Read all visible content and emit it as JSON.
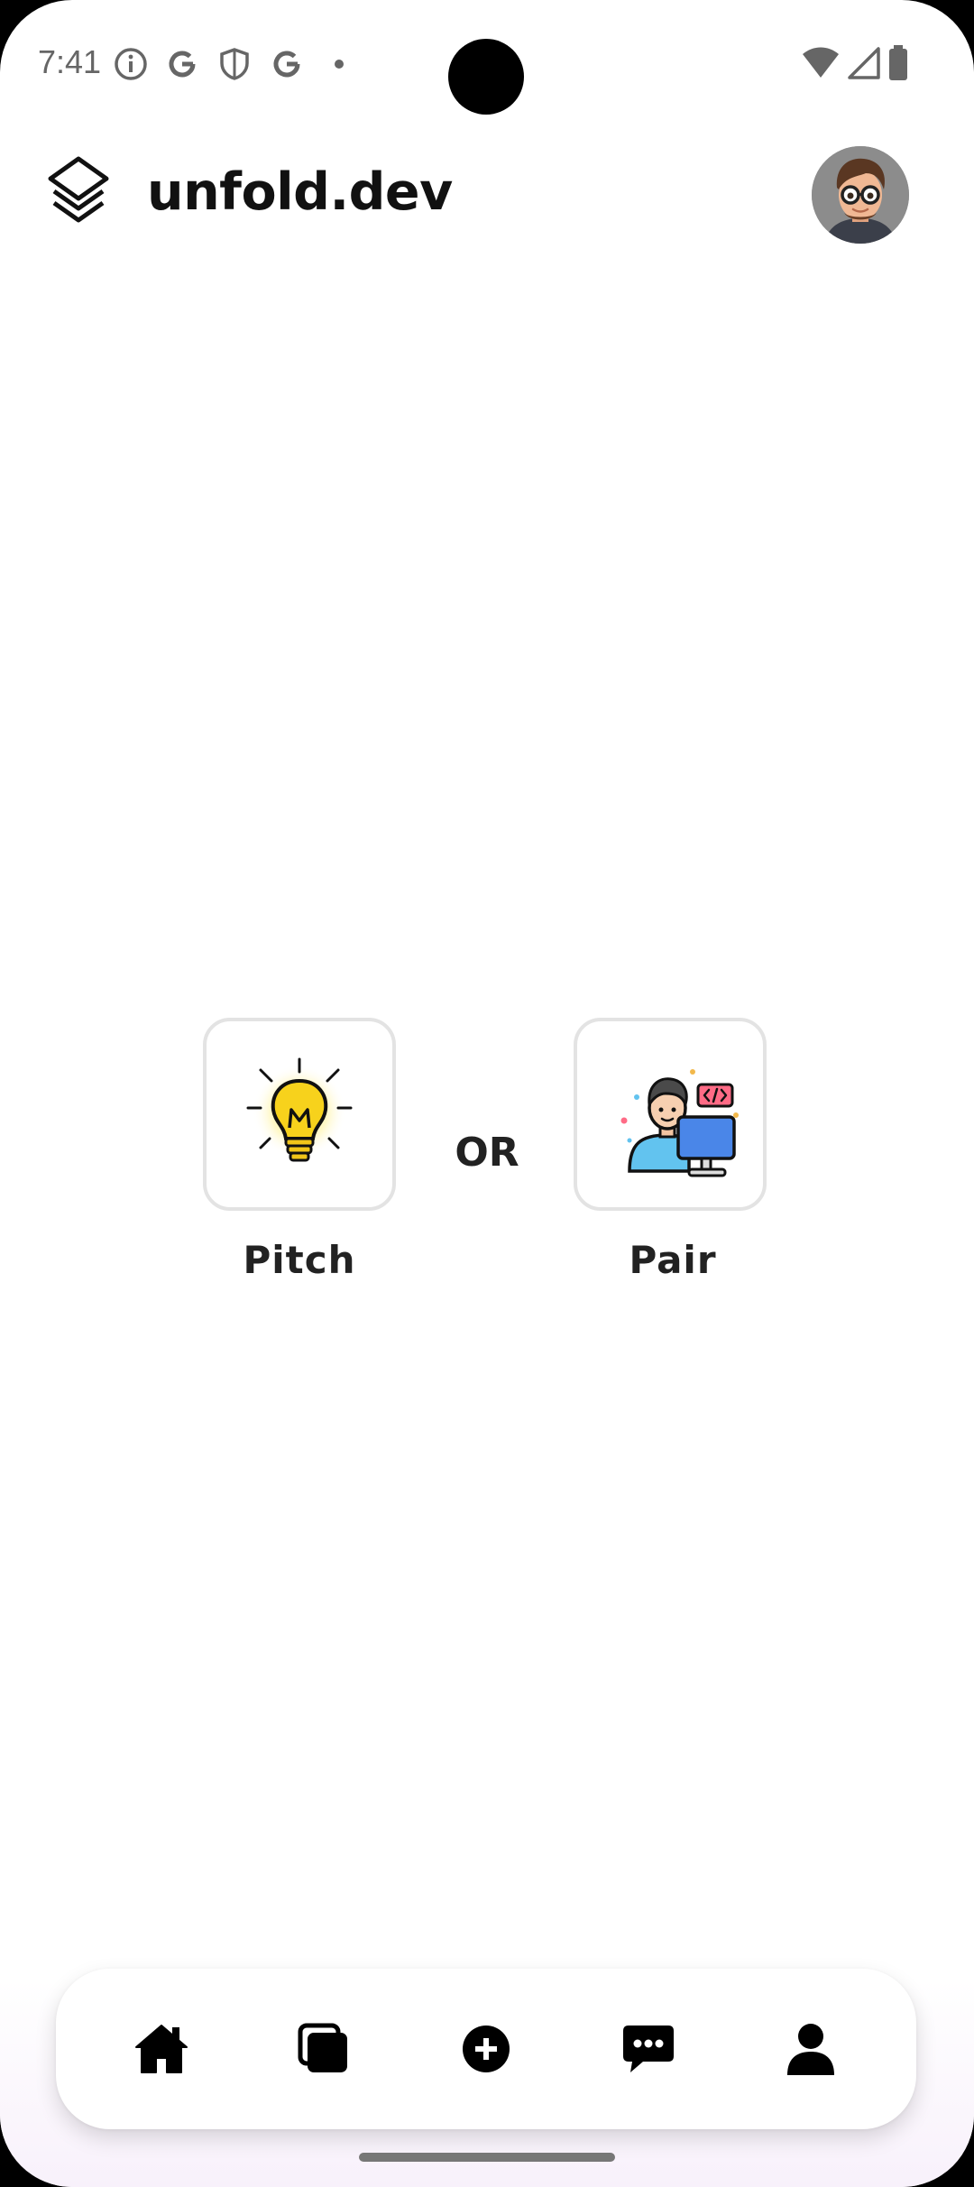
{
  "status_bar": {
    "time": "7:41",
    "left_icons": [
      "info-icon",
      "google-icon",
      "shield-icon",
      "google-icon",
      "dot-icon"
    ],
    "right_icons": [
      "wifi-icon",
      "cellular-signal-icon",
      "battery-icon"
    ]
  },
  "header": {
    "logo_icon": "layers-icon",
    "title": "unfold.dev",
    "avatar_icon": "user-avatar"
  },
  "choices": {
    "pitch": {
      "label": "Pitch",
      "icon": "lightbulb-icon"
    },
    "separator": "OR",
    "pair": {
      "label": "Pair",
      "icon": "developer-at-computer-icon"
    }
  },
  "bottom_nav": {
    "items": [
      {
        "icon": "home-icon"
      },
      {
        "icon": "cards-icon"
      },
      {
        "icon": "add-circle-icon"
      },
      {
        "icon": "chat-icon"
      },
      {
        "icon": "profile-icon"
      }
    ]
  },
  "colors": {
    "background": "#ffffff",
    "text": "#111111",
    "card_border": "#e3e3e3",
    "nav_tint": "#f8f1fb",
    "bulb_yellow": "#f7d21c"
  }
}
